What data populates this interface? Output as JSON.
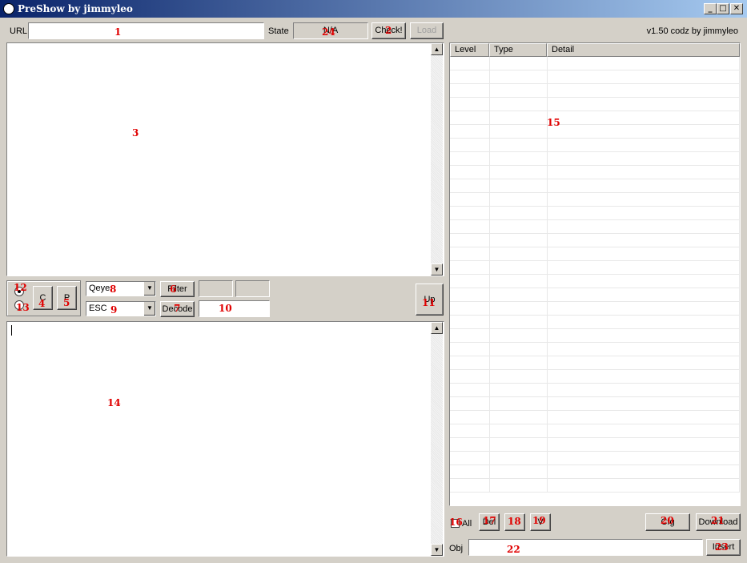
{
  "window": {
    "title": "PreShow by jimmyleo",
    "minimize": "_",
    "maximize": "□",
    "close": "✕"
  },
  "top": {
    "url_label": "URL",
    "url_value": "",
    "state_label": "State",
    "state_value": "N/A",
    "check_label": "Check!",
    "load_label": "Load",
    "version": "v1.50 codz by jimmyleo"
  },
  "controls": {
    "c_label": "C",
    "p_label": "P",
    "combo1_value": "Qeye",
    "combo2_value": "ESC",
    "filter_label": "Filter",
    "decode_label": "Decode",
    "up_label": "Up",
    "field10_value": ""
  },
  "listview": {
    "columns": [
      "Level",
      "Type",
      "Detail"
    ],
    "row_count": 32
  },
  "bottom": {
    "all_label": "All",
    "del_label": "Del",
    "b18_label": "",
    "b19_label": "V",
    "b20_label": "Cfg",
    "download_label": "Download",
    "obj_label": "Obj",
    "obj_value": "",
    "insert_label": "Insert"
  },
  "annotations": [
    "1",
    "2",
    "3",
    "4",
    "5",
    "6",
    "7",
    "8",
    "9",
    "10",
    "11",
    "12",
    "13",
    "14",
    "15",
    "16",
    "17",
    "18",
    "19",
    "20",
    "21",
    "22",
    "23",
    "24"
  ]
}
